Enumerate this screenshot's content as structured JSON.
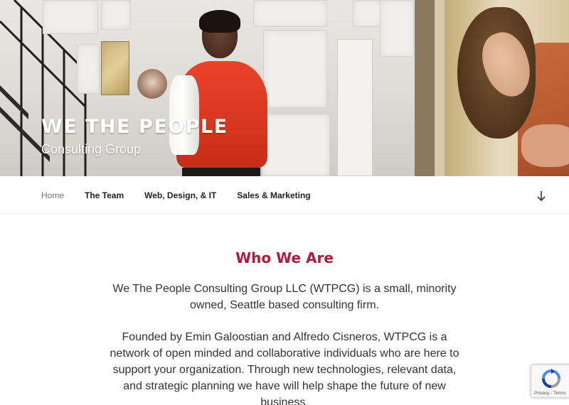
{
  "site": {
    "title": "WE THE PEOPLE",
    "tagline": "Consulting Group"
  },
  "nav": {
    "items": [
      {
        "label": "Home",
        "current": true
      },
      {
        "label": "The Team",
        "current": false
      },
      {
        "label": "Web, Design, & IT",
        "current": false
      },
      {
        "label": "Sales & Marketing",
        "current": false
      }
    ],
    "scroll_icon": "arrow-down-icon"
  },
  "main": {
    "heading": "Who We Are",
    "paragraphs": [
      "We The People Consulting Group LLC (WTPCG) is a small, minority owned, Seattle based consulting firm.",
      "Founded by Emin Galoostian and Alfredo Cisneros, WTPCG is a network of open minded and collaborative individuals who are here to support your organization. Through new technologies, relevant data, and strategic planning we have will help shape the future of new business."
    ]
  },
  "recaptcha": {
    "terms": "Privacy - Terms",
    "icon": "recaptcha-icon"
  },
  "colors": {
    "heading_accent": "#b6183a",
    "nav_current": "#767676",
    "text": "#333333"
  }
}
